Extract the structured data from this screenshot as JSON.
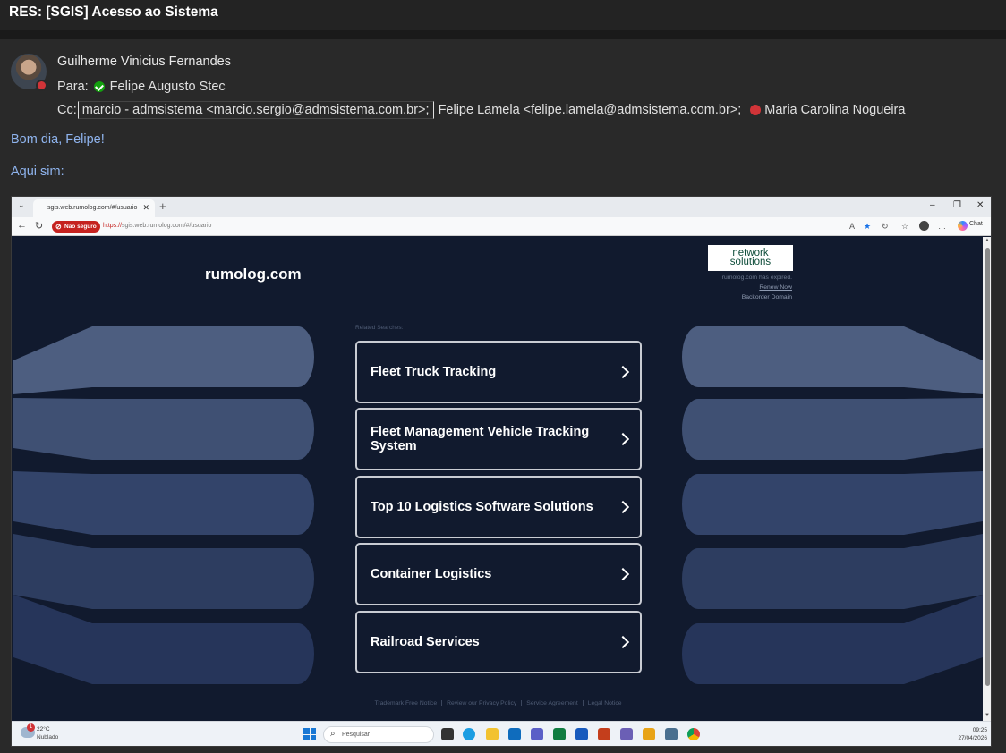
{
  "email": {
    "subject": "RES: [SGIS] Acesso ao Sistema",
    "sender": "Guilherme Vinicius Fernandes",
    "to_label": "Para:",
    "to_name": "Felipe Augusto Stec",
    "cc_label": "Cc:",
    "cc_1": "marcio - admsistema <marcio.sergio@admsistema.com.br>;",
    "cc_2": "Felipe Lamela <felipe.lamela@admsistema.com.br>;",
    "cc_3": "Maria Carolina Nogueira",
    "greeting": "Bom dia, Felipe!",
    "line2": "Aqui sim:"
  },
  "browser": {
    "tab_title": "sgis.web.rumolog.com/#/usuario",
    "security_badge": "Não seguro",
    "url_protocol": "https://",
    "url_rest": "sgis.web.rumolog.com/#/usuario",
    "chat_label": "Chat"
  },
  "page": {
    "brand": "rumolog.com",
    "ns_logo_line1": "network",
    "ns_logo_line2": "solutions",
    "expired_text": "rumolog.com has expired.",
    "renew_link": "Renew Now",
    "backorder_link": "Backorder Domain",
    "related_label": "Related Searches:",
    "searches": [
      "Fleet Truck Tracking",
      "Fleet Management Vehicle Tracking System",
      "Top 10 Logistics Software Solutions",
      "Container Logistics",
      "Railroad Services"
    ],
    "footer": [
      "Trademark Free Notice",
      "Review our Privacy Policy",
      "Service Agreement",
      "Legal Notice"
    ]
  },
  "taskbar": {
    "weather_badge": "1",
    "temperature": "22°C",
    "condition": "Nublado",
    "search_placeholder": "Pesquisar",
    "time": "09:25",
    "date": "27/04/2026"
  },
  "colors": {
    "page_bg": "#111a2e",
    "link_blue": "#8fb4ee",
    "status_available": "#13a10e",
    "status_busy": "#d13438"
  }
}
